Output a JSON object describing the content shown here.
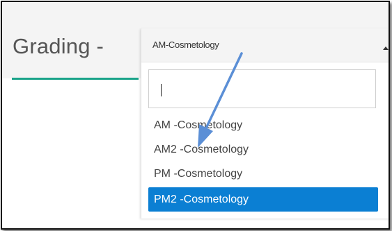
{
  "page": {
    "title": "Grading -"
  },
  "select": {
    "value": "AM-Cosmetology",
    "search_value": "",
    "options": [
      {
        "label": "AM -Cosmetology",
        "selected": false
      },
      {
        "label": "AM2 -Cosmetology",
        "selected": false
      },
      {
        "label": "PM -Cosmetology",
        "selected": false
      },
      {
        "label": "PM2 -Cosmetology",
        "selected": true
      }
    ]
  },
  "colors": {
    "accent_teal": "#1aa389",
    "selected_blue": "#0b7fd3",
    "annotation_arrow": "#5b8fd6"
  },
  "icons": {
    "caret": "caret-up-icon",
    "annotation": "annotation-arrow-icon"
  }
}
